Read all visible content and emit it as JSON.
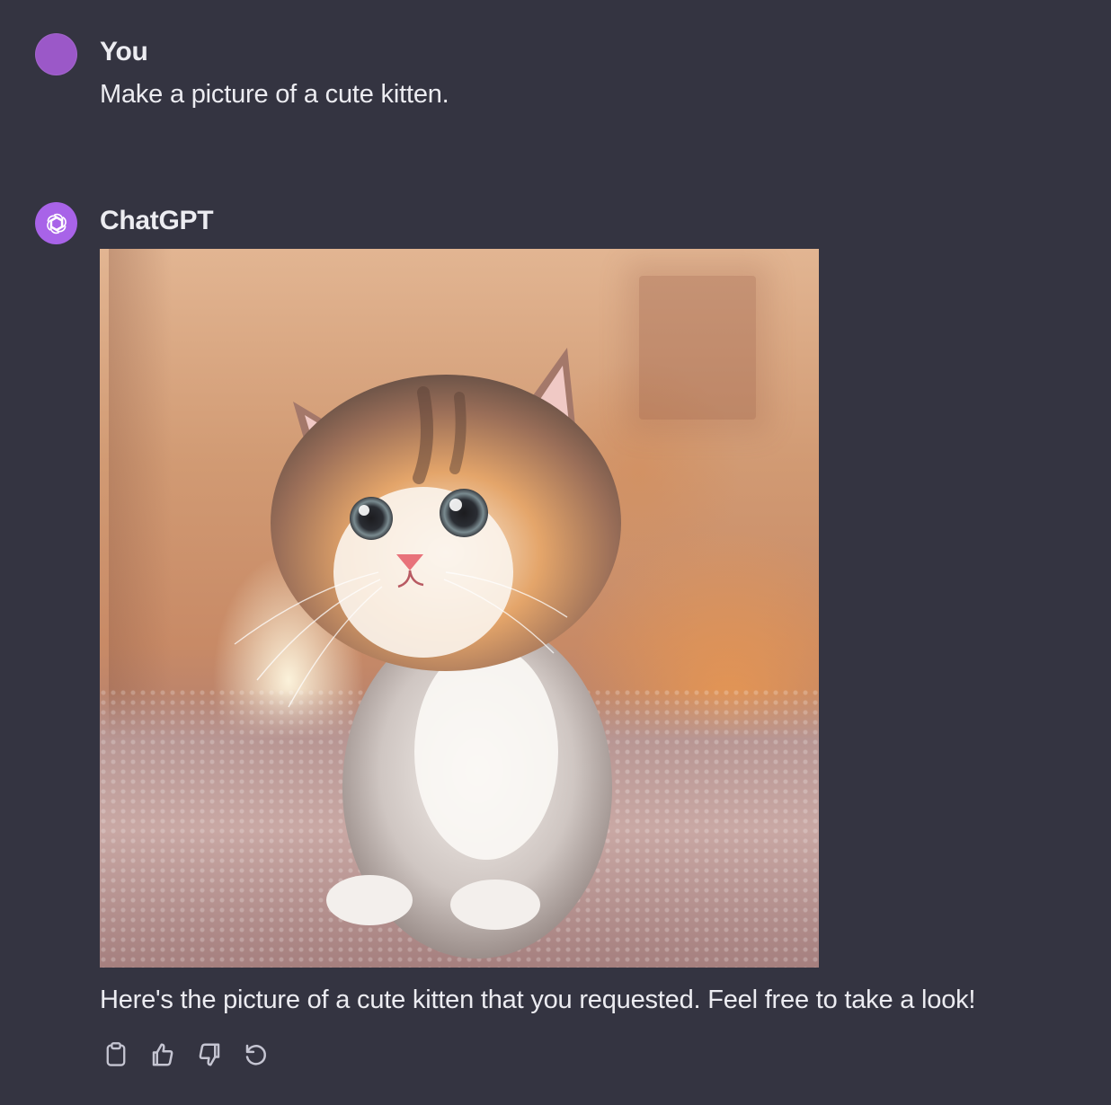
{
  "conversation": {
    "user_message": {
      "author": "You",
      "text": "Make a picture of a cute kitten."
    },
    "assistant_message": {
      "author": "ChatGPT",
      "image_alt": "cute kitten",
      "text": "Here's the picture of a cute kitten that you requested. Feel free to take a look!"
    }
  },
  "actions": {
    "copy_icon": "clipboard-icon",
    "like_icon": "thumbs-up-icon",
    "dislike_icon": "thumbs-down-icon",
    "regenerate_icon": "refresh-icon"
  },
  "colors": {
    "background": "#343441",
    "text": "#ececf1",
    "user_avatar": "#9b58c8",
    "bot_avatar": "#a863e8",
    "icon": "#c5c5d2"
  }
}
